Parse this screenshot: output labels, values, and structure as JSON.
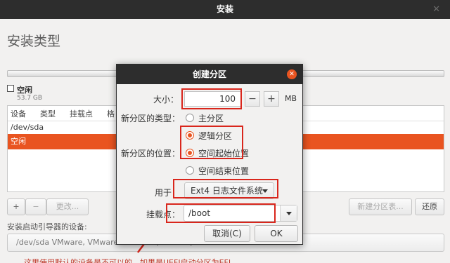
{
  "window": {
    "title": "安装",
    "close_glyph": "✕"
  },
  "page_title": "安装类型",
  "free_space": {
    "label": "空闲",
    "size": "53.7 GB"
  },
  "partition_table": {
    "columns": [
      "设备",
      "类型",
      "挂载点",
      "格"
    ],
    "device": "/dev/sda",
    "selected_row": "空闲"
  },
  "toolbar": {
    "add": "+",
    "remove": "−",
    "change": "更改...",
    "new_table": "新建分区表...",
    "revert": "还原"
  },
  "bootloader": {
    "label": "安装启动引导器的设备:",
    "value": "/dev/sda   VMware, VMware Virtual S (53.7 GB)"
  },
  "bottom_note": "这里使用默认的设备是不可以的，如果是UEFI启动分区为EFI...",
  "dialog": {
    "title": "创建分区",
    "close_glyph": "✕",
    "size_label": "大小：",
    "size_value": "100",
    "minus": "−",
    "plus": "+",
    "unit": "MB",
    "type_label": "新分区的类型：",
    "type_primary": "主分区",
    "type_logical": "逻辑分区",
    "location_label": "新分区的位置：",
    "location_start": "空间起始位置",
    "location_end": "空间结束位置",
    "use_label": "用于：",
    "use_value": "Ext4 日志文件系统",
    "mount_label": "挂载点：",
    "mount_value": "/boot",
    "cancel": "取消(C)",
    "ok": "OK"
  },
  "colors": {
    "accent": "#e95420",
    "annotation": "#d9261c",
    "titlebar": "#2d2d2d"
  }
}
